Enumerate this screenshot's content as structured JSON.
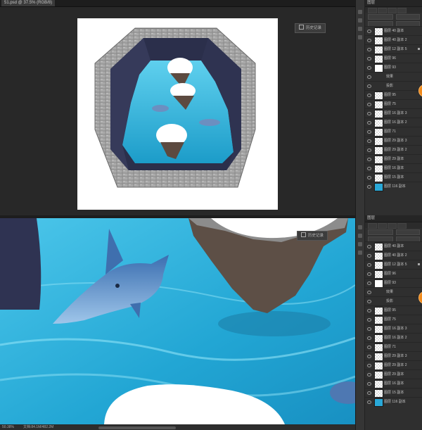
{
  "window": {
    "doc_tab": "51.psd @ 37.5% (RGB/8)"
  },
  "panel": {
    "title": "图层",
    "layers": [
      {
        "name": "图层 40 副本",
        "thumb": "checker",
        "locked": false
      },
      {
        "name": "图层 40 副本 2",
        "thumb": "checker",
        "locked": false
      },
      {
        "name": "图层 12 副本 5",
        "thumb": "checker",
        "locked": true
      },
      {
        "name": "图层 96",
        "thumb": "checker",
        "locked": false
      },
      {
        "name": "图层 93",
        "thumb": "mask",
        "locked": false
      },
      {
        "name": "效果",
        "thumb": "none",
        "locked": false
      },
      {
        "name": "投影",
        "thumb": "none",
        "locked": false
      },
      {
        "name": "图层 95",
        "thumb": "checker",
        "locked": false
      },
      {
        "name": "图层 75",
        "thumb": "checker",
        "locked": false
      },
      {
        "name": "图层 16 副本 3",
        "thumb": "checker",
        "locked": false
      },
      {
        "name": "图层 16 副本 2",
        "thumb": "checker",
        "locked": false
      },
      {
        "name": "图层 71",
        "thumb": "checker",
        "locked": false
      },
      {
        "name": "图层 29 副本 3",
        "thumb": "checker",
        "locked": false
      },
      {
        "name": "图层 29 副本 2",
        "thumb": "checker",
        "locked": false
      },
      {
        "name": "图层 29 副本",
        "thumb": "checker",
        "locked": false
      },
      {
        "name": "图层 16 副本",
        "thumb": "checker",
        "locked": false
      },
      {
        "name": "图层 15 副本",
        "thumb": "checker",
        "locked": false
      },
      {
        "name": "图层 116 副本",
        "thumb": "water",
        "locked": false
      }
    ]
  },
  "history_button": "历史记录",
  "status": {
    "zoom": "50.38%",
    "doc_size": "文档:84.1M/482.2M"
  },
  "colors": {
    "water": "#29a8d8",
    "accent_badge": "#f08a1c"
  }
}
